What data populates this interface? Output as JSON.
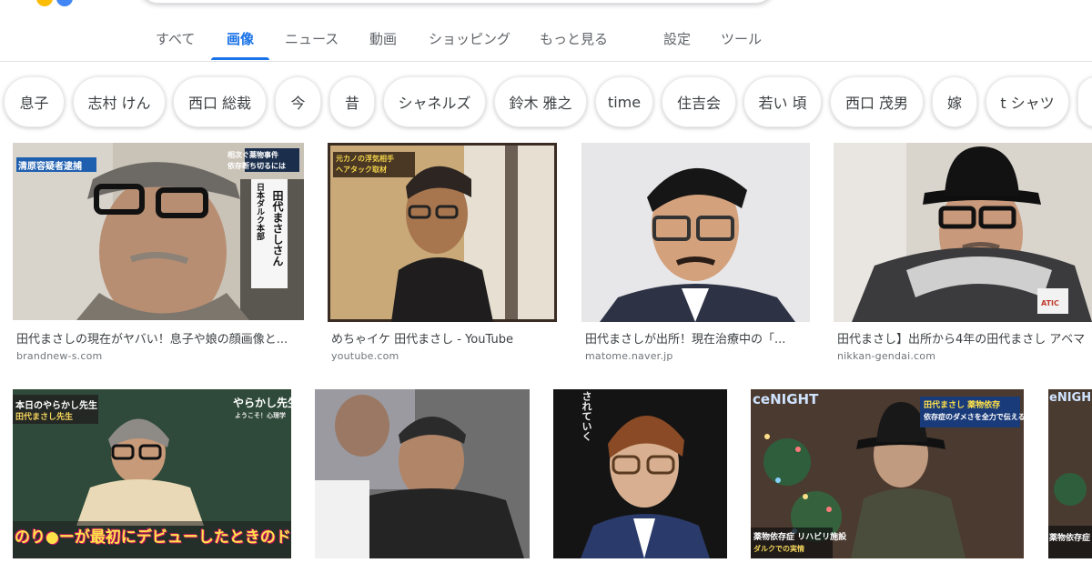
{
  "header": {
    "tabs": [
      {
        "label": "すべて",
        "active": false
      },
      {
        "label": "画像",
        "active": true
      },
      {
        "label": "ニュース",
        "active": false
      },
      {
        "label": "動画",
        "active": false
      },
      {
        "label": "ショッピング",
        "active": false
      },
      {
        "label": "もっと見る",
        "active": false
      },
      {
        "label": "設定",
        "active": false
      },
      {
        "label": "ツール",
        "active": false
      }
    ]
  },
  "chips": [
    "息子",
    "志村 けん",
    "西口 総裁",
    "今",
    "昔",
    "シャネルズ",
    "鈴木 雅之",
    "time",
    "住吉会",
    "若い 頃",
    "西口 茂男",
    "嫁",
    "t シャツ"
  ],
  "results": [
    {
      "caption": "田代まさしの現在がヤバい！息子や娘の顔画像と...",
      "source": "brandnew-s.com",
      "overlay": {
        "badge": "清原容疑者逮捕",
        "headline1": "相次ぐ薬物事件",
        "headline2": "依存断ち切るには",
        "vertical1": "日本ダルク本部",
        "vertical2": "田代まさしさん"
      }
    },
    {
      "caption": "めちゃイケ 田代まさし - YouTube",
      "source": "youtube.com",
      "overlay": {
        "tele1": "元カノの浮気相手",
        "tele2": "へアタック取材"
      }
    },
    {
      "caption": "田代まさしが出所！現在治療中の「...",
      "source": "matome.naver.jp"
    },
    {
      "caption": "田代まさし】出所から4年の田代まさし アベマ",
      "source": "nikkan-gendai.com",
      "overlay": {
        "sticker": "ATIC"
      }
    },
    {
      "caption": "",
      "source": "",
      "overlay": {
        "top1": "本日のやらかし先生",
        "top2": "田代まさし先生",
        "right1": "やらかし先生",
        "right2": "ようこそ！心理学",
        "bottom": "のり●ーが最初にデビューしたときのドッキリで"
      }
    },
    {
      "caption": "",
      "source": ""
    },
    {
      "caption": "",
      "source": "",
      "overlay": {
        "vertical": "されていく"
      }
    },
    {
      "caption": "",
      "source": "",
      "overlay": {
        "corner": "ceNIGHT",
        "top1": "田代まさし 薬物依存",
        "top2": "依存症のダメさを全力で伝える",
        "bottom1": "薬物依存症 リハビリ施設",
        "bottom2": "ダルクでの実情"
      }
    },
    {
      "caption": "",
      "source": "",
      "overlay": {
        "corner": "eNIGH",
        "bottom": "薬物依存症"
      }
    }
  ]
}
